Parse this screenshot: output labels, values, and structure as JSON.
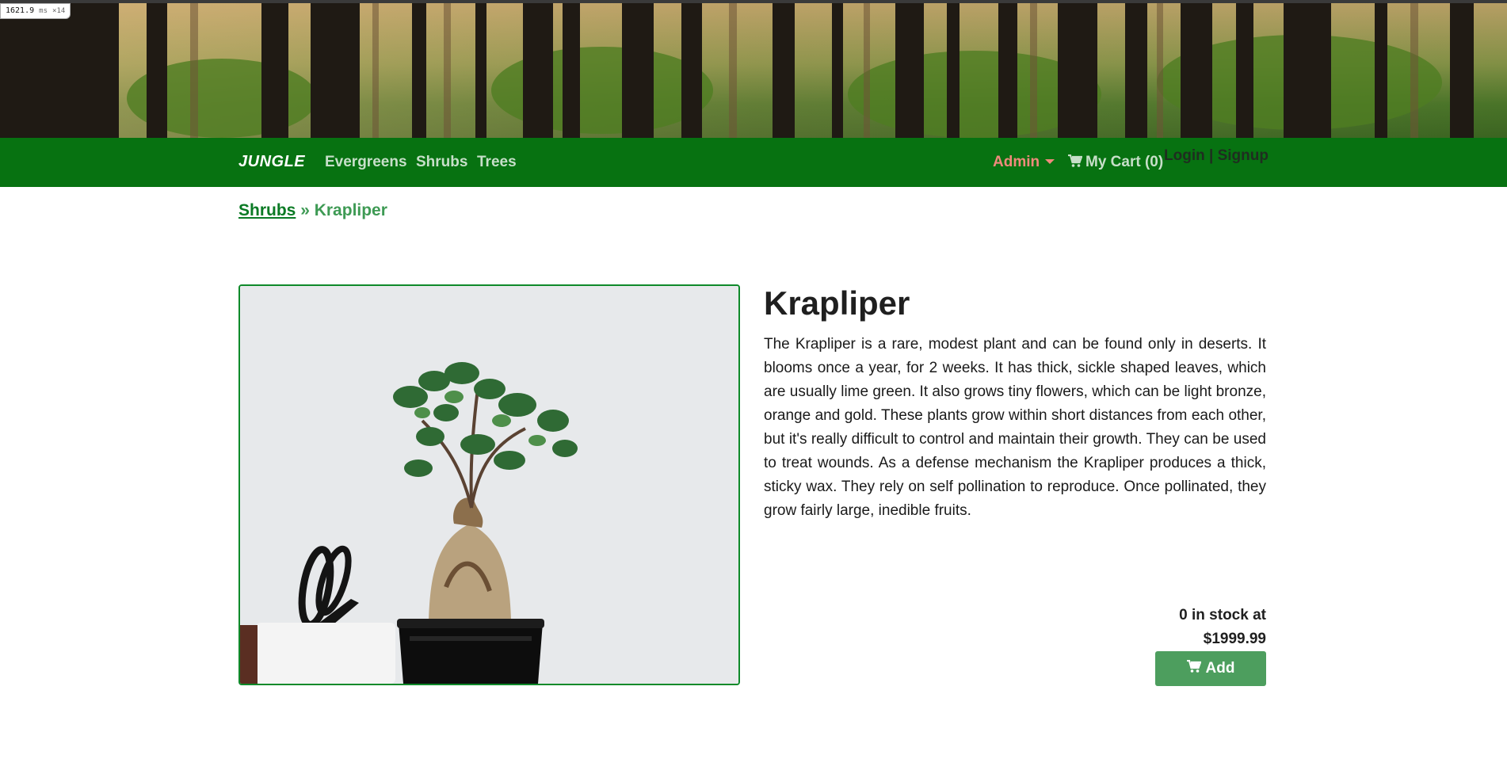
{
  "perf": {
    "value": "1621.9",
    "unit": "ms",
    "multiplier": "×14"
  },
  "nav": {
    "brand": "JUNGLE",
    "links": [
      "Evergreens",
      "Shrubs",
      "Trees"
    ],
    "admin_label": "Admin",
    "cart_label": "My Cart (0)",
    "login_label": "Login",
    "separator": "|",
    "signup_label": "Signup"
  },
  "breadcrumb": {
    "category": "Shrubs",
    "separator": "»",
    "current": "Krapliper"
  },
  "product": {
    "name": "Krapliper",
    "description": "The Krapliper is a rare, modest plant and can be found only in deserts. It blooms once a year, for 2 weeks. It has thick, sickle shaped leaves, which are usually lime green. It also grows tiny flowers, which can be light bronze, orange and gold. These plants grow within short distances from each other, but it's really difficult to control and maintain their growth. They can be used to treat wounds. As a defense mechanism the Krapliper produces a thick, sticky wax. They rely on self pollination to reproduce. Once pollinated, they grow fairly large, inedible fruits.",
    "stock_line": "0 in stock at",
    "price": "$1999.99",
    "add_label": "Add"
  },
  "icons": {
    "cart": "shopping-cart-icon",
    "caret": "caret-down-icon"
  },
  "colors": {
    "navbar": "#077211",
    "admin": "#f08a7c",
    "add_button": "#4d9e5e",
    "image_border": "#0f8a2a"
  }
}
